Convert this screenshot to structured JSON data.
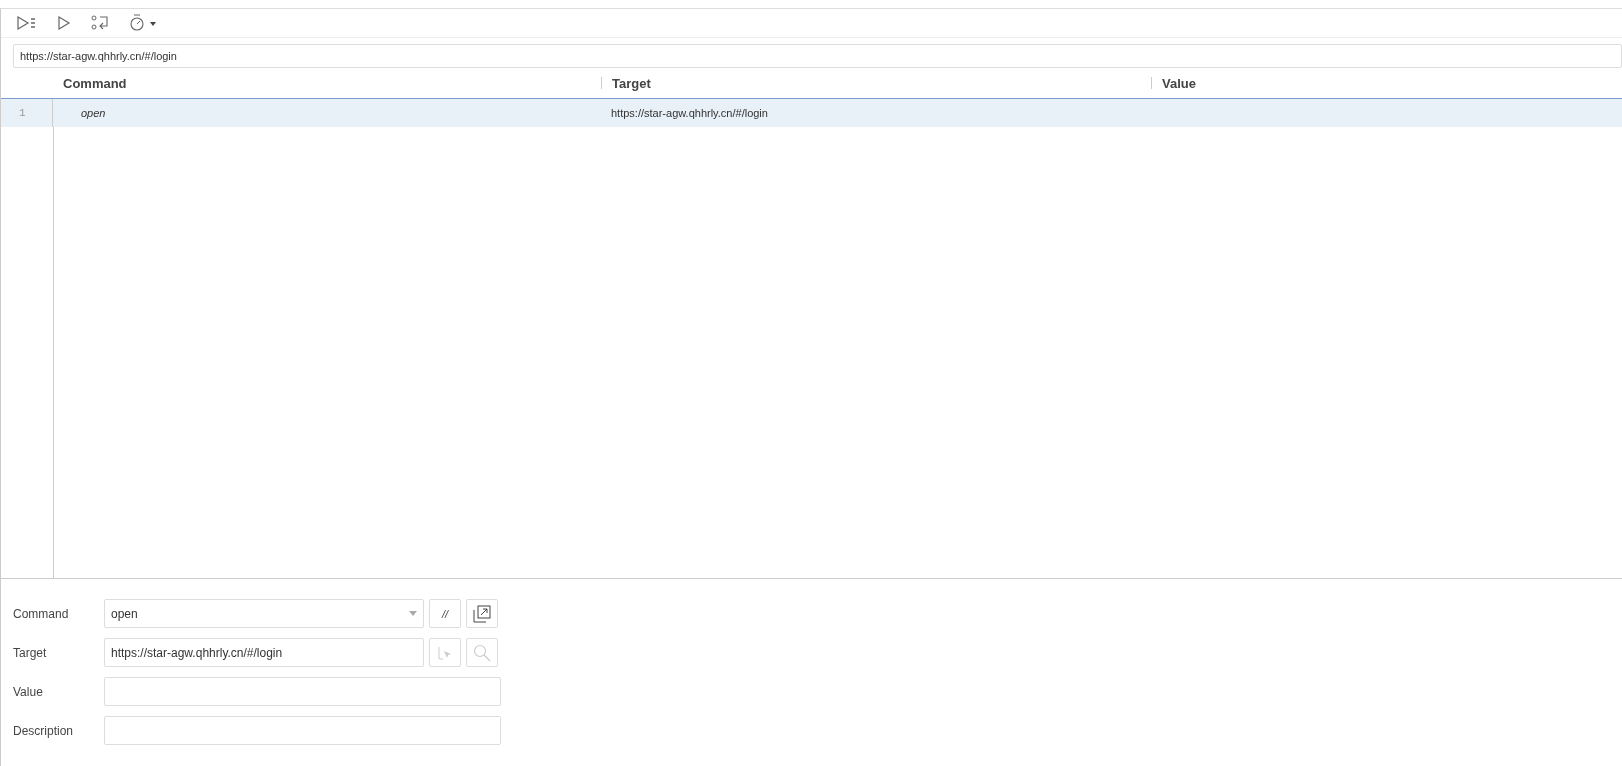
{
  "base_url": {
    "value": "https://star-agw.qhhrly.cn/#/login"
  },
  "table": {
    "columns": [
      "Command",
      "Target",
      "Value"
    ],
    "rows": [
      {
        "number": "1",
        "command": "open",
        "target": "https://star-agw.qhhrly.cn/#/login",
        "selected": true
      }
    ]
  },
  "editor": {
    "command": {
      "label": "Command",
      "value": "open",
      "comment_button": "//"
    },
    "target": {
      "label": "Target",
      "value": "https://star-agw.qhhrly.cn/#/login"
    },
    "value": {
      "label": "Value"
    },
    "description": {
      "label": "Description"
    }
  }
}
